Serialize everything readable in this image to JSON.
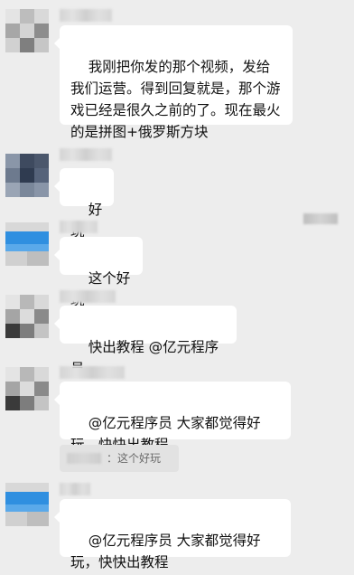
{
  "messages": [
    {
      "id": "m1",
      "text": "我刚把你发的那个视频，发给我们运营。得到回复就是，那个游戏已经是很久之前的了。现在最火的是拼图+俄罗斯方块"
    },
    {
      "id": "m2",
      "text": "好玩"
    },
    {
      "id": "m3",
      "text": "这个好玩"
    },
    {
      "id": "m4",
      "text": "快出教程 @亿元程序员"
    },
    {
      "id": "m5",
      "text": "@亿元程序员 大家都觉得好玩，快快出教程",
      "quote": "：这个好玩"
    },
    {
      "id": "m6",
      "text": "@亿元程序员 大家都觉得好玩，快快出教程"
    }
  ],
  "colors": {
    "background": "#ededed",
    "bubble": "#ffffff",
    "quote_bg": "#e2e2e2"
  }
}
